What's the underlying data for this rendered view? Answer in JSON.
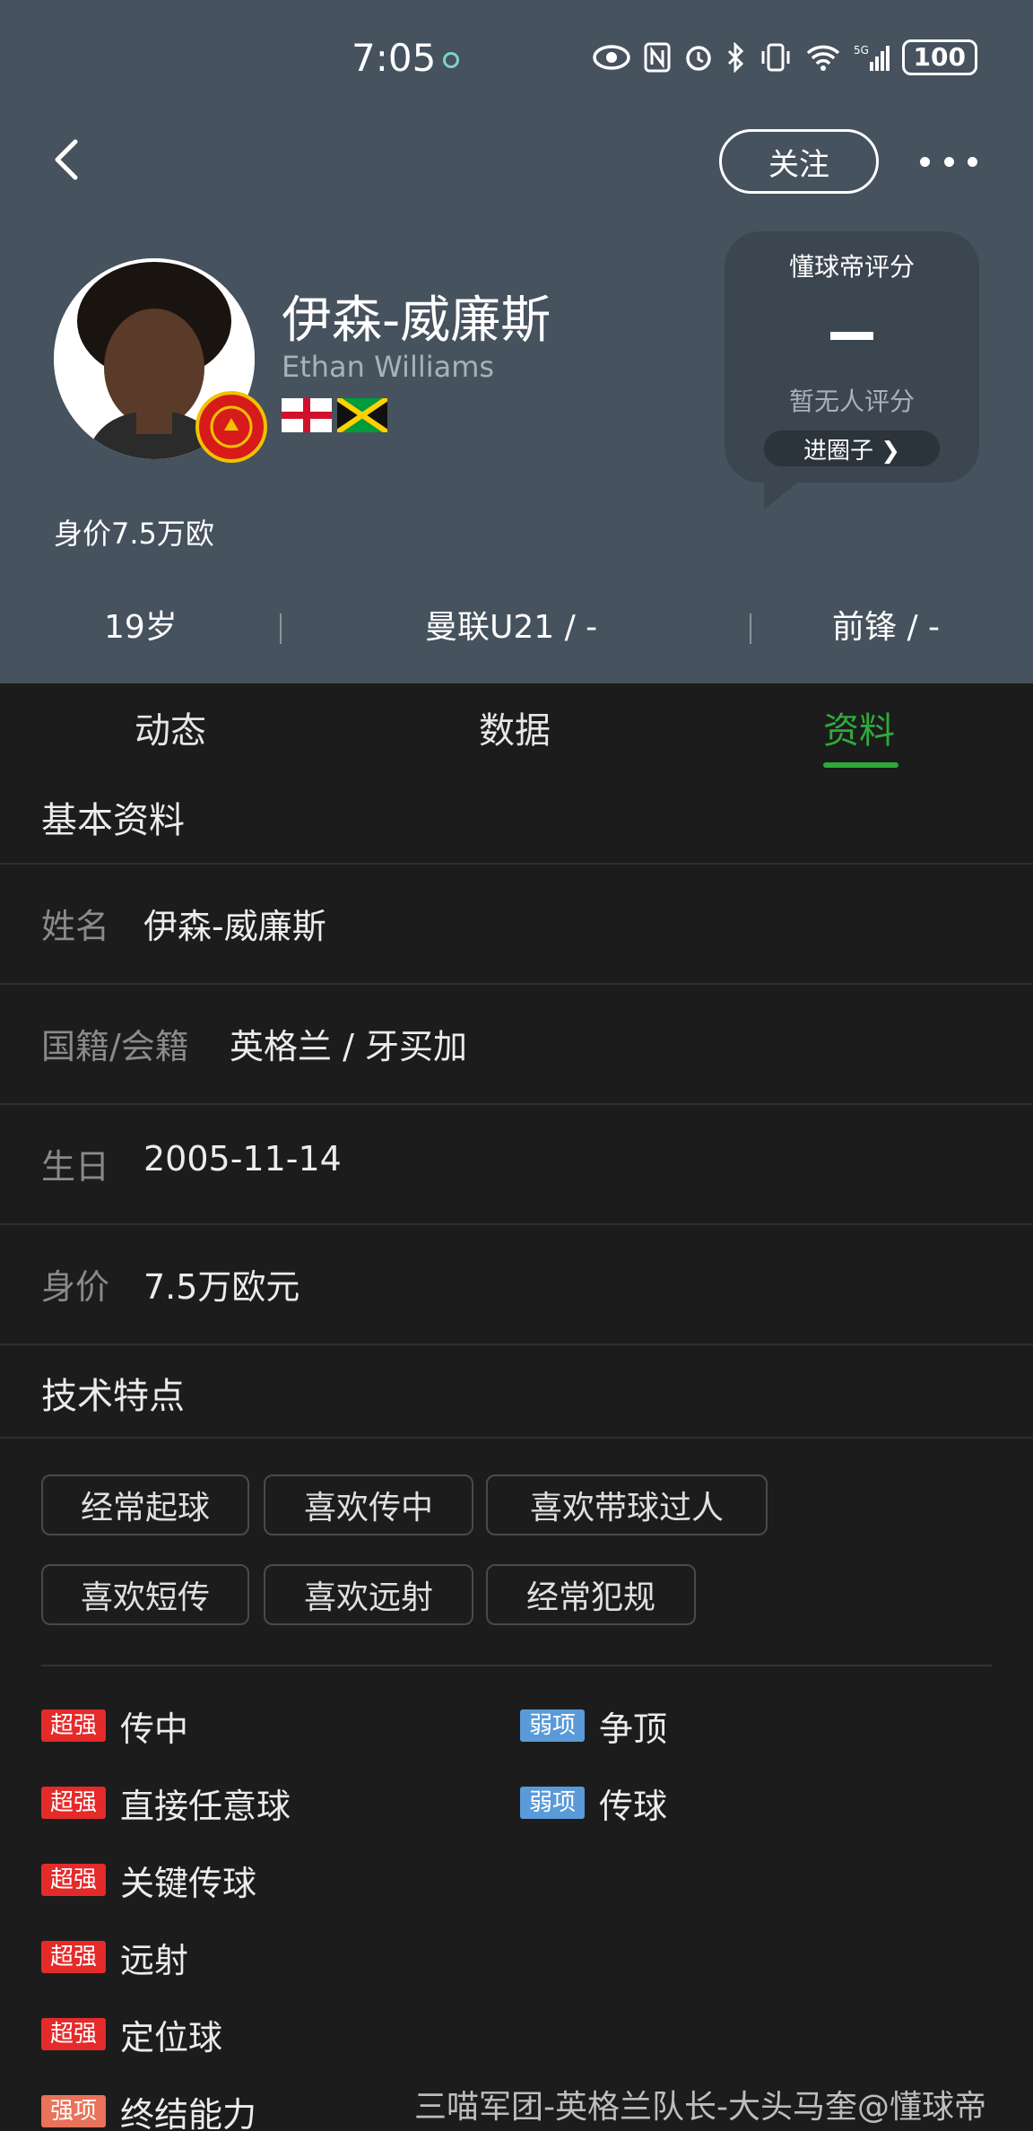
{
  "status_bar": {
    "time": "7:05",
    "battery": "100",
    "network": "5G"
  },
  "header": {
    "follow_label": "关注"
  },
  "player": {
    "name_cn": "伊森-威廉斯",
    "name_en": "Ethan Williams",
    "market_value_line": "身价7.5万欧"
  },
  "rating": {
    "title": "懂球帝评分",
    "value": "-",
    "empty_text": "暂无人评分",
    "circle_button": "进圈子 ❯"
  },
  "summary": {
    "age": "19岁",
    "club": "曼联U21 / -",
    "position": "前锋 / -"
  },
  "tabs": [
    {
      "label": "动态",
      "active": false
    },
    {
      "label": "数据",
      "active": false
    },
    {
      "label": "资料",
      "active": true
    }
  ],
  "colors": {
    "accent": "#2eaa3c",
    "hero_bg": "#46525e",
    "page_bg": "#1c1c1c",
    "super_badge": "#e52a2a",
    "weak_badge": "#5a9ad8",
    "strong_badge": "#e8735a"
  },
  "basic_info": {
    "title": "基本资料",
    "rows": [
      {
        "label": "姓名",
        "value": "伊森-威廉斯"
      },
      {
        "label": "国籍/会籍",
        "value": "英格兰 / 牙买加"
      },
      {
        "label": "生日",
        "value": "2005-11-14"
      },
      {
        "label": "身价",
        "value": "7.5万欧元"
      }
    ]
  },
  "tech": {
    "title": "技术特点",
    "tags": [
      "经常起球",
      "喜欢传中",
      "喜欢带球过人",
      "喜欢短传",
      "喜欢远射",
      "经常犯规"
    ],
    "strengths": [
      {
        "badge": "超强",
        "label": "传中"
      },
      {
        "badge": "超强",
        "label": "直接任意球"
      },
      {
        "badge": "超强",
        "label": "关键传球"
      },
      {
        "badge": "超强",
        "label": "远射"
      },
      {
        "badge": "超强",
        "label": "定位球"
      },
      {
        "badge": "强项",
        "label": "终结能力"
      }
    ],
    "weaknesses": [
      {
        "badge": "弱项",
        "label": "争顶"
      },
      {
        "badge": "弱项",
        "label": "传球"
      }
    ]
  },
  "watermark": "三喵军团-英格兰队长-大头马奎@懂球帝"
}
